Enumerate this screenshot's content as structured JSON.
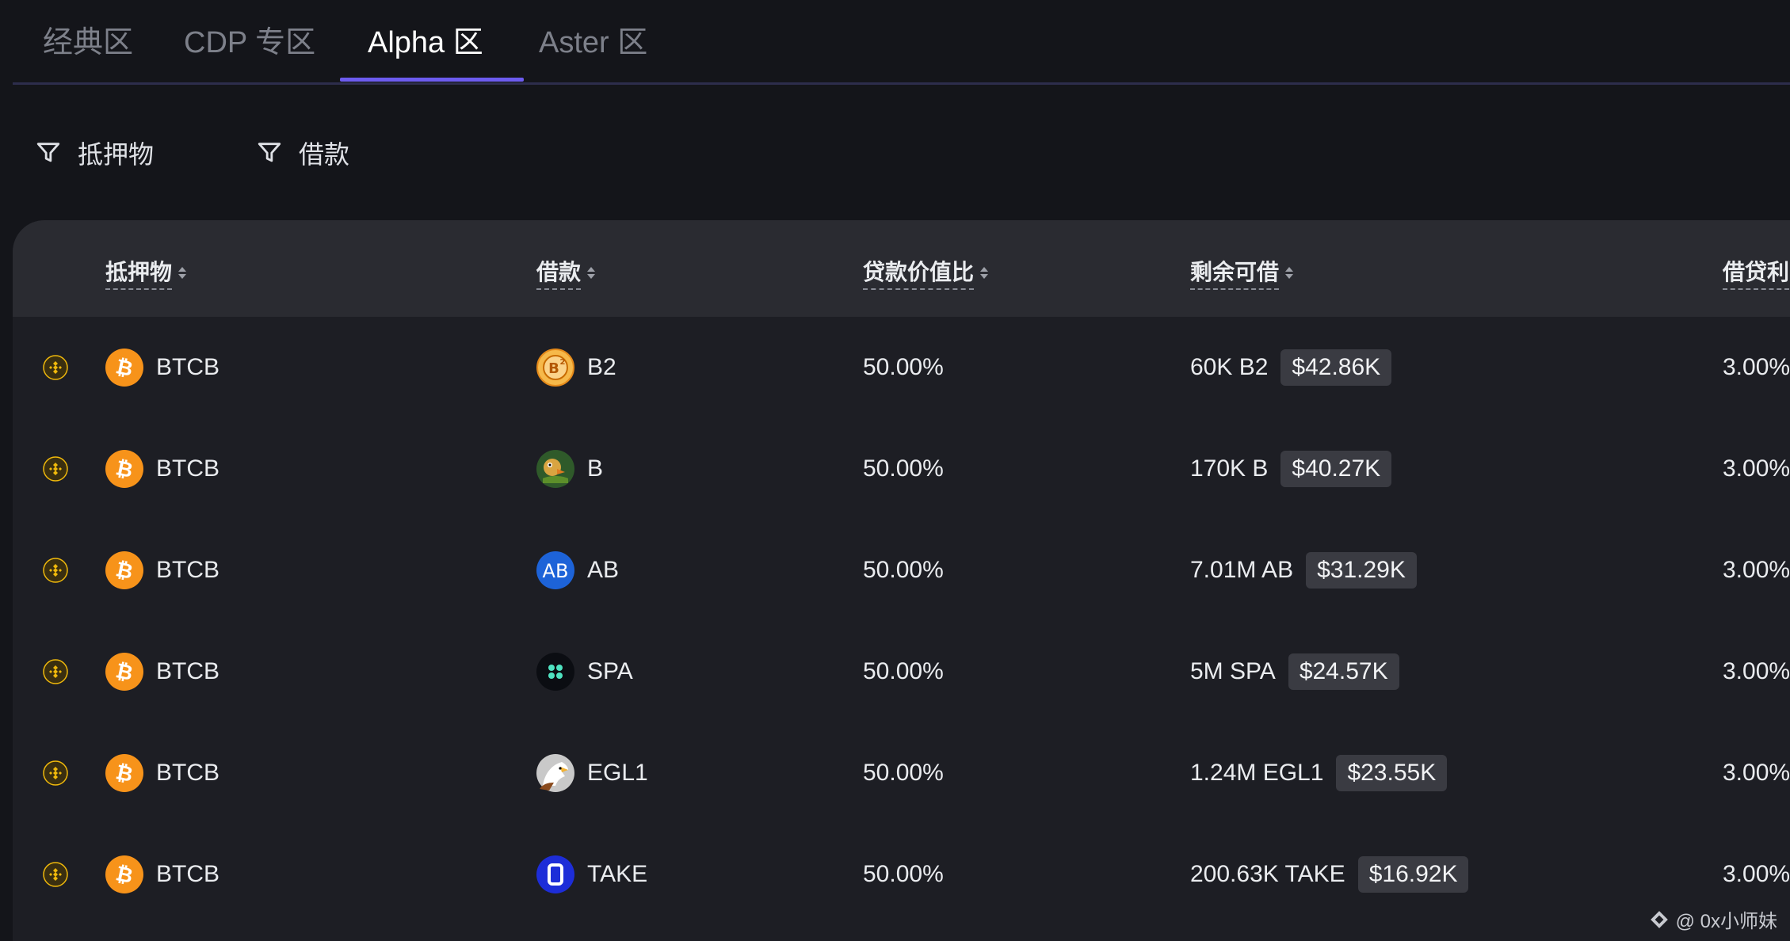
{
  "tabs": [
    {
      "label": "经典区"
    },
    {
      "label": "CDP 专区"
    },
    {
      "label": "Alpha 区",
      "active": true
    },
    {
      "label": "Aster 区"
    }
  ],
  "filters": {
    "collateral_label": "抵押物",
    "borrow_label": "借款",
    "icon": "filter-icon"
  },
  "table": {
    "headers": {
      "collateral": "抵押物",
      "borrow": "借款",
      "ltv": "贷款价值比",
      "remaining": "剩余可借",
      "rate": "借贷利"
    },
    "rows": [
      {
        "collateral": "BTCB",
        "borrow": "B2",
        "borrow_icon": "b2-coin-icon",
        "ltv": "50.00%",
        "remaining": "60K B2",
        "remaining_usd": "$42.86K",
        "rate": "3.00%"
      },
      {
        "collateral": "BTCB",
        "borrow": "B",
        "borrow_icon": "b-coin-icon",
        "ltv": "50.00%",
        "remaining": "170K B",
        "remaining_usd": "$40.27K",
        "rate": "3.00%"
      },
      {
        "collateral": "BTCB",
        "borrow": "AB",
        "borrow_icon": "ab-coin-icon",
        "ltv": "50.00%",
        "remaining": "7.01M AB",
        "remaining_usd": "$31.29K",
        "rate": "3.00%"
      },
      {
        "collateral": "BTCB",
        "borrow": "SPA",
        "borrow_icon": "spa-coin-icon",
        "ltv": "50.00%",
        "remaining": "5M SPA",
        "remaining_usd": "$24.57K",
        "rate": "3.00%"
      },
      {
        "collateral": "BTCB",
        "borrow": "EGL1",
        "borrow_icon": "egl1-coin-icon",
        "ltv": "50.00%",
        "remaining": "1.24M EGL1",
        "remaining_usd": "$23.55K",
        "rate": "3.00%"
      },
      {
        "collateral": "BTCB",
        "borrow": "TAKE",
        "borrow_icon": "take-coin-icon",
        "ltv": "50.00%",
        "remaining": "200.63K TAKE",
        "remaining_usd": "$16.92K",
        "rate": "3.00%"
      }
    ]
  },
  "watermark": "@ 0x小师妹",
  "colors": {
    "background": "#14151a",
    "table_bg": "#1d1e24",
    "header_bg": "#2a2b31",
    "accent": "#6d5cf0",
    "btc_orange": "#f7931a",
    "bnb_gold": "#f0b90b"
  }
}
